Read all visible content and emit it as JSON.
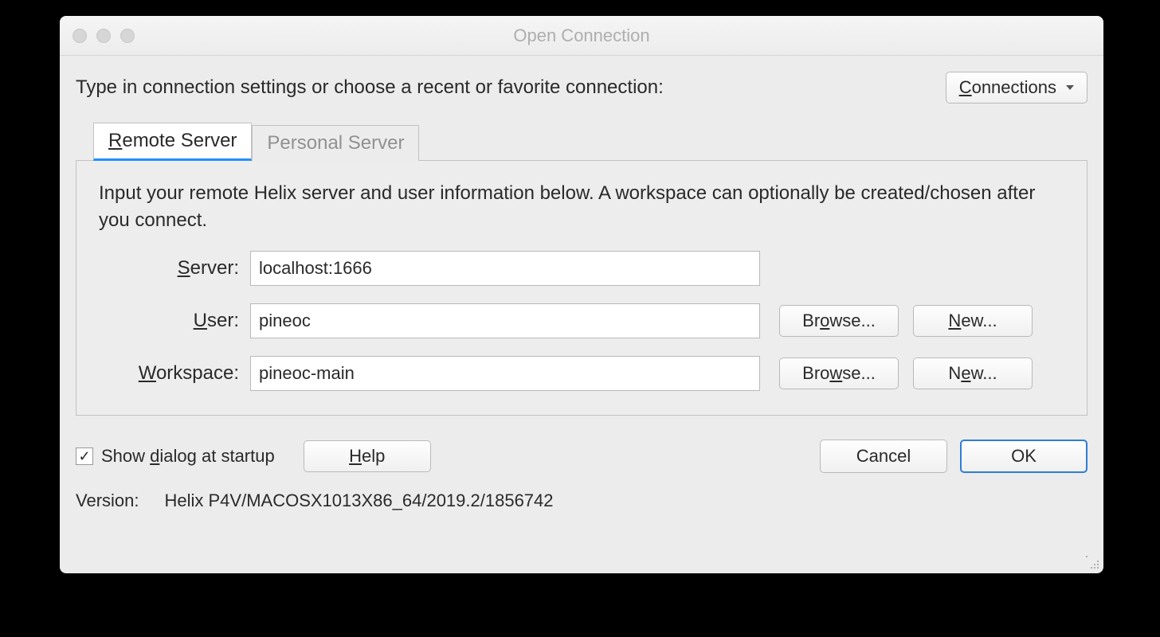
{
  "titlebar": {
    "title": "Open Connection"
  },
  "instruction": "Type in connection settings or choose a recent or favorite connection:",
  "connections_btn": "Connections",
  "tabs": {
    "remote": "Remote Server",
    "personal": "Personal Server"
  },
  "panel": {
    "instruction": "Input your remote Helix server and user information below. A workspace can optionally be created/chosen after you connect.",
    "server_label": "Server:",
    "server_value": "localhost:1666",
    "user_label": "User:",
    "user_value": "pineoc",
    "workspace_label": "Workspace:",
    "workspace_value": "pineoc-main",
    "browse": "Browse...",
    "new": "New..."
  },
  "footer": {
    "show_dialog": "Show dialog at startup",
    "help": "Help",
    "cancel": "Cancel",
    "ok": "OK",
    "version_label": "Version:",
    "version_value": "Helix P4V/MACOSX1013X86_64/2019.2/1856742"
  }
}
